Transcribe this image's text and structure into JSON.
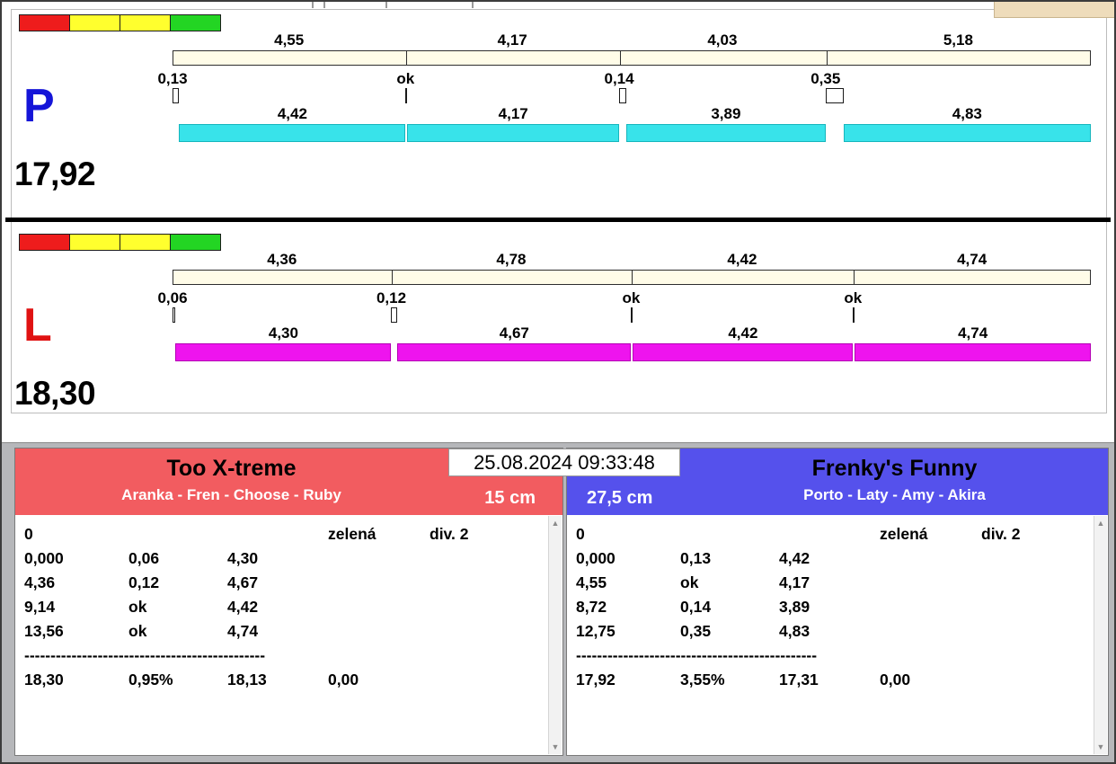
{
  "meta": {
    "datetime": "25.08.2024 09:33:48"
  },
  "ui": {
    "scroll_up": "▲",
    "scroll_down": "▼"
  },
  "lanes": [
    {
      "label": "P",
      "label_color": "#1515d8",
      "total_label": "17,92",
      "status_lights": [
        "#ee1c1c",
        "#ffff2e",
        "#ffff2e",
        "#23d523"
      ],
      "split_bar_color": "#fffce8",
      "run_bar_color": "#38e3ea",
      "run_bar_border": "#17b6bd",
      "splits": [
        4.55,
        4.17,
        4.03,
        5.18
      ],
      "split_labels": [
        "4,55",
        "4,17",
        "4,03",
        "5,18"
      ],
      "changes": [
        0.13,
        0,
        0.14,
        0.35
      ],
      "change_labels": [
        "0,13",
        "ok",
        "0,14",
        "0,35"
      ],
      "runs": [
        4.42,
        4.17,
        3.89,
        4.83
      ],
      "run_labels": [
        "4,42",
        "4,17",
        "3,89",
        "4,83"
      ]
    },
    {
      "label": "L",
      "label_color": "#e01212",
      "total_label": "18,30",
      "status_lights": [
        "#ee1c1c",
        "#ffff2e",
        "#ffff2e",
        "#23d523"
      ],
      "split_bar_color": "#fffce8",
      "run_bar_color": "#ee14ee",
      "run_bar_border": "#b400b4",
      "splits": [
        4.36,
        4.78,
        4.42,
        4.74
      ],
      "split_labels": [
        "4,36",
        "4,78",
        "4,42",
        "4,74"
      ],
      "changes": [
        0.06,
        0.12,
        0,
        0
      ],
      "change_labels": [
        "0,06",
        "0,12",
        "ok",
        "ok"
      ],
      "runs": [
        4.3,
        4.67,
        4.42,
        4.74
      ],
      "run_labels": [
        "4,30",
        "4,67",
        "4,42",
        "4,74"
      ]
    }
  ],
  "teams": [
    {
      "name": "Too X-treme",
      "members": "Aranka - Fren - Choose - Ruby",
      "jump_height": "15 cm",
      "header_color": "#f25c60",
      "info": {
        "start": "0",
        "light": "zelená",
        "division": "div. 2"
      },
      "runs": [
        [
          "0,000",
          "0,06",
          "4,30"
        ],
        [
          "4,36",
          "0,12",
          "4,67"
        ],
        [
          "9,14",
          "ok",
          "4,42"
        ],
        [
          "13,56",
          "ok",
          "4,74"
        ]
      ],
      "separator": "----------------------------------------------",
      "totals": [
        "18,30",
        "0,95%",
        "18,13",
        "0,00"
      ]
    },
    {
      "name": "Frenky's Funny",
      "members": "Porto - Laty - Amy - Akira",
      "jump_height": "27,5 cm",
      "header_color": "#5551ec",
      "info": {
        "start": "0",
        "light": "zelená",
        "division": "div. 2"
      },
      "runs": [
        [
          "0,000",
          "0,13",
          "4,42"
        ],
        [
          "4,55",
          "ok",
          "4,17"
        ],
        [
          "8,72",
          "0,14",
          "3,89"
        ],
        [
          "12,75",
          "0,35",
          "4,83"
        ]
      ],
      "separator": "----------------------------------------------",
      "totals": [
        "17,92",
        "3,55%",
        "17,31",
        "0,00"
      ]
    }
  ]
}
